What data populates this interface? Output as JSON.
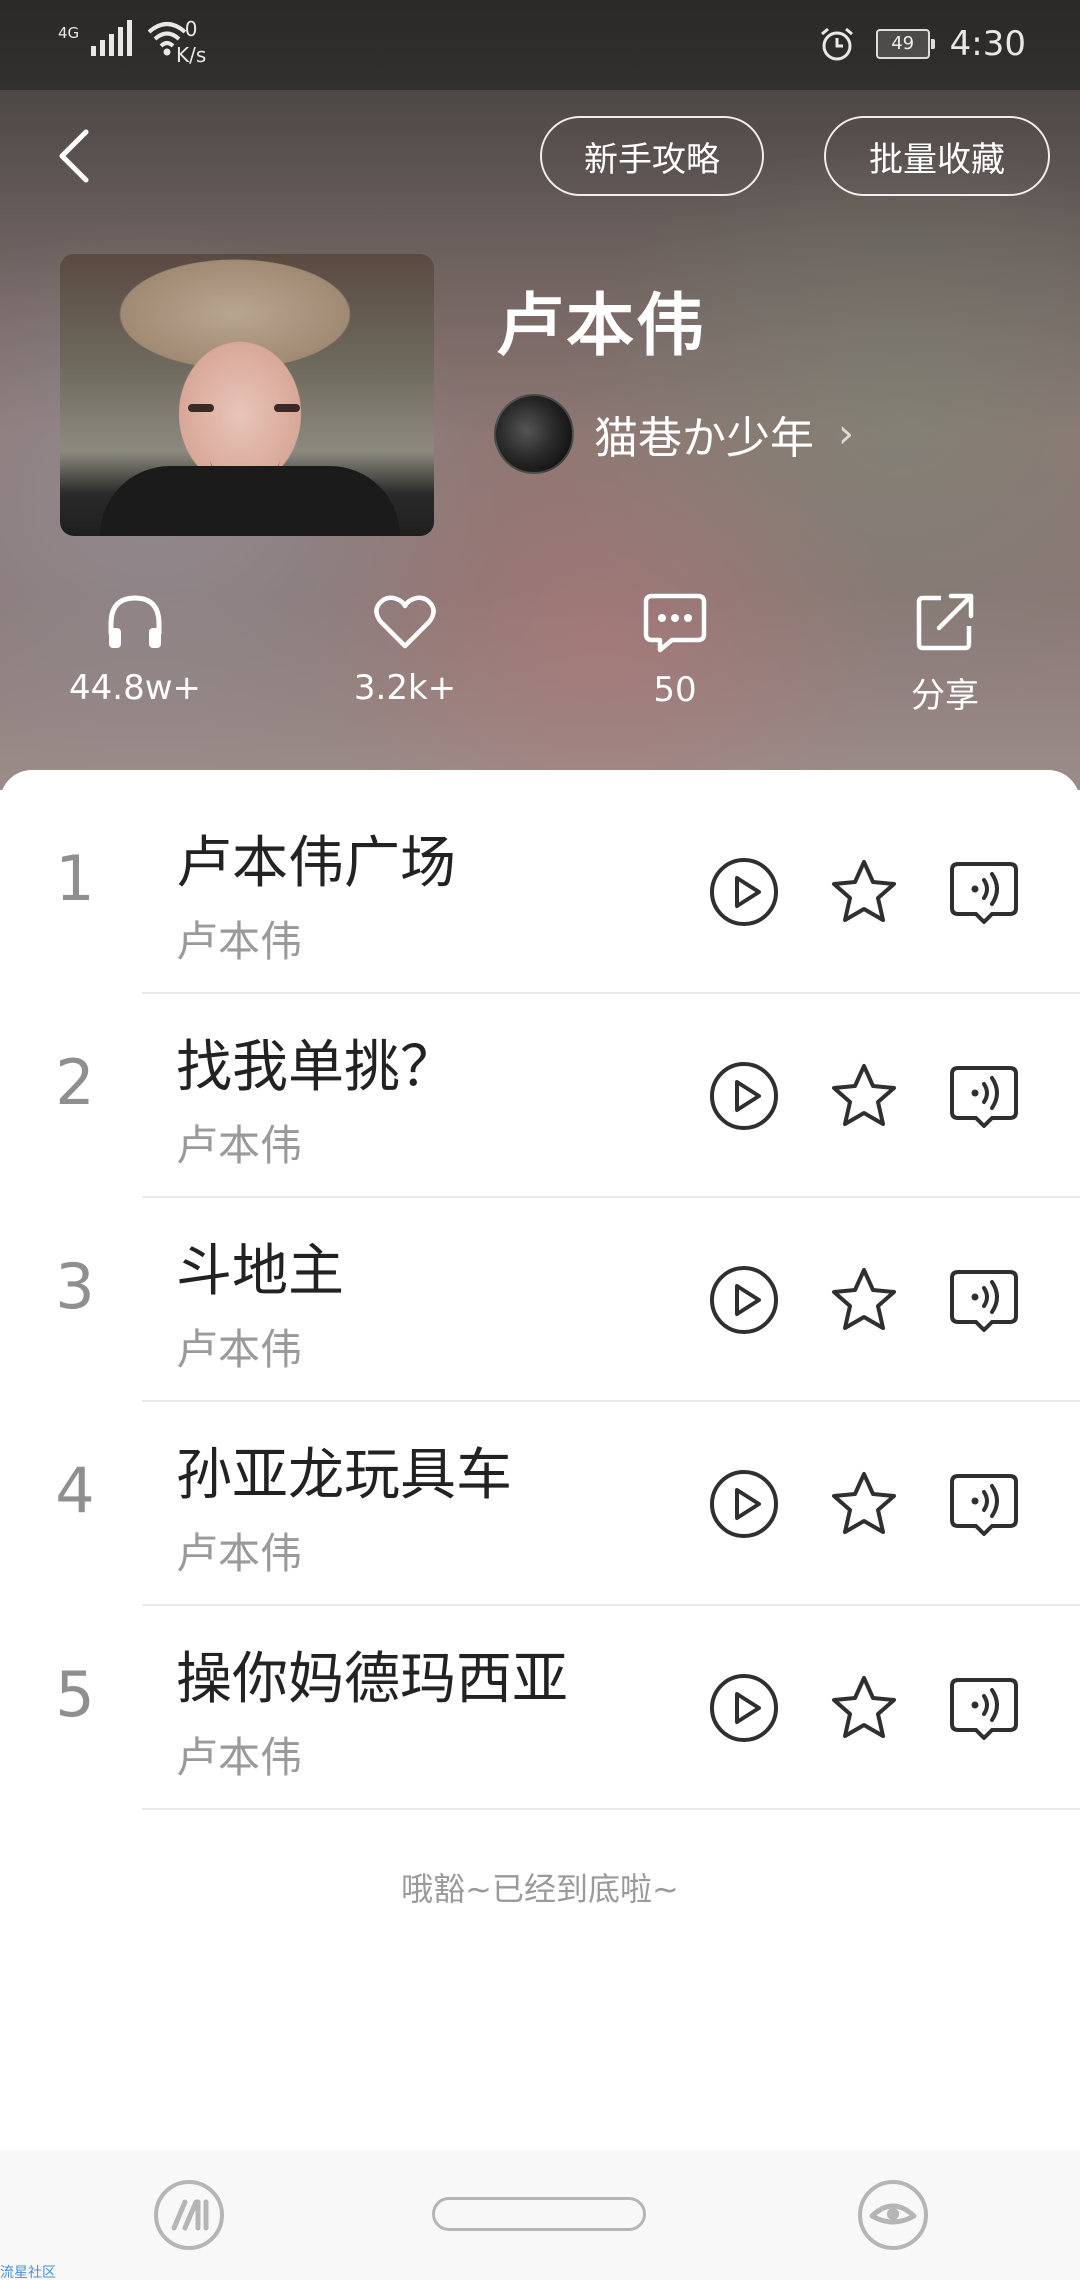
{
  "status_bar": {
    "signal_label": "4G",
    "net_speed_value": "0",
    "net_speed_unit": "K/s",
    "battery": "49",
    "time": "4:30"
  },
  "header": {
    "guide_button": "新手攻略",
    "batch_button": "批量收藏"
  },
  "playlist": {
    "title": "卢本伟",
    "creator": "猫巷か少年"
  },
  "stats": {
    "listens": "44.8w+",
    "likes": "3.2k+",
    "comments": "50",
    "share": "分享"
  },
  "songs": [
    {
      "index": "1",
      "title": "卢本伟广场",
      "artist": "卢本伟"
    },
    {
      "index": "2",
      "title": "找我单挑？",
      "artist": "卢本伟"
    },
    {
      "index": "3",
      "title": "斗地主",
      "artist": "卢本伟"
    },
    {
      "index": "4",
      "title": "孙亚龙玩具车",
      "artist": "卢本伟"
    },
    {
      "index": "5",
      "title": "操你妈德玛西亚",
      "artist": "卢本伟"
    }
  ],
  "end_note": "哦豁~已经到底啦~",
  "watermark": "流星社区",
  "colors": {
    "title_text": "#222222",
    "secondary_text": "#9a9a9a",
    "icon_stroke": "#2f2f2f"
  }
}
